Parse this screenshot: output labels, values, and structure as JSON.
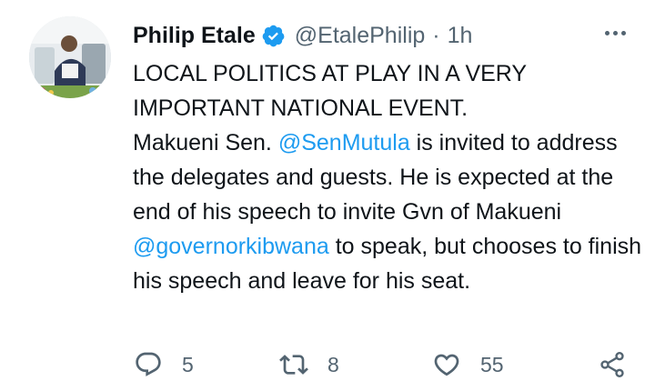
{
  "author": {
    "name": "Philip Etale",
    "handle": "@EtalePhilip",
    "separator": "·",
    "time": "1h"
  },
  "tweet": {
    "line1": "LOCAL POLITICS AT PLAY IN A VERY",
    "line2": "IMPORTANT NATIONAL EVENT.",
    "text_a": "Makueni Sen. ",
    "mention_1": "@SenMutula",
    "text_b": " is invited to address the delegates and guests. He is expected at the end of his speech to invite Gvn of Makueni ",
    "mention_2": "@governorkibwana",
    "text_c": " to speak, but chooses to finish his speech and leave for his seat."
  },
  "actions": {
    "replies": "5",
    "retweets": "8",
    "likes": "55"
  },
  "colors": {
    "accent": "#1d9bf0",
    "text": "#0f1419",
    "muted": "#536471"
  },
  "icons": [
    "verified-badge-icon",
    "more-options-icon",
    "reply-icon",
    "retweet-icon",
    "like-icon",
    "share-icon"
  ]
}
